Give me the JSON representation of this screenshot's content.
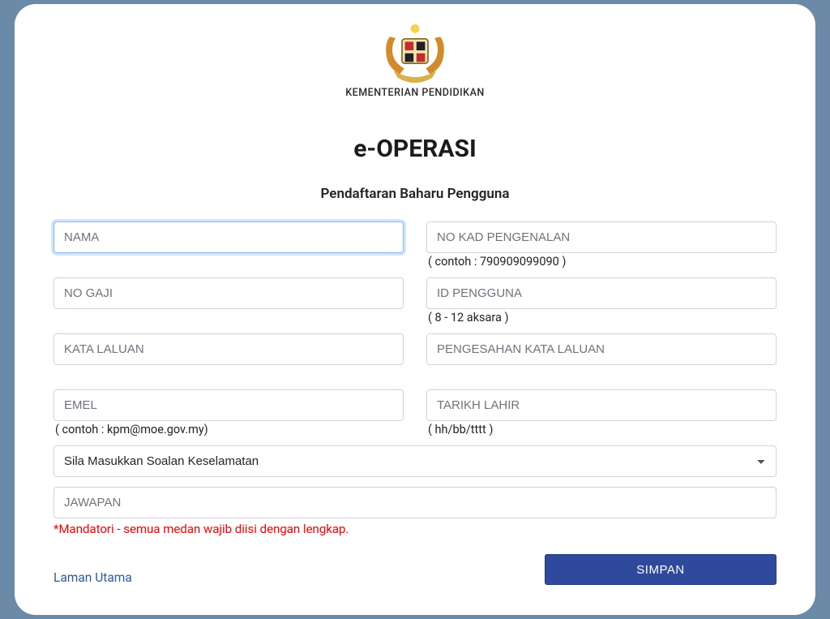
{
  "header": {
    "ministry": "KEMENTERIAN PENDIDIKAN",
    "app_title": "e-OPERASI",
    "page_subtitle": "Pendaftaran Baharu Pengguna"
  },
  "fields": {
    "name": {
      "placeholder": "NAMA",
      "hint": ""
    },
    "ic": {
      "placeholder": "NO KAD PENGENALAN",
      "hint": "( contoh : 790909099090 )"
    },
    "salary_no": {
      "placeholder": "NO GAJI",
      "hint": ""
    },
    "user_id": {
      "placeholder": "ID PENGGUNA",
      "hint": "( 8 - 12 aksara )"
    },
    "password": {
      "placeholder": "KATA LALUAN",
      "hint": ""
    },
    "password_confirm": {
      "placeholder": "PENGESAHAN KATA LALUAN",
      "hint": ""
    },
    "email": {
      "placeholder": "EMEL",
      "hint": "( contoh : kpm@moe.gov.my)"
    },
    "dob": {
      "placeholder": "TARIKH LAHIR",
      "hint": "( hh/bb/tttt )"
    },
    "security_q": {
      "selected": "Sila Masukkan Soalan Keselamatan"
    },
    "answer": {
      "placeholder": "JAWAPAN"
    }
  },
  "messages": {
    "mandatory": "*Mandatori - semua medan wajib diisi dengan lengkap."
  },
  "actions": {
    "home_link": "Laman Utama",
    "save": "SIMPAN"
  }
}
